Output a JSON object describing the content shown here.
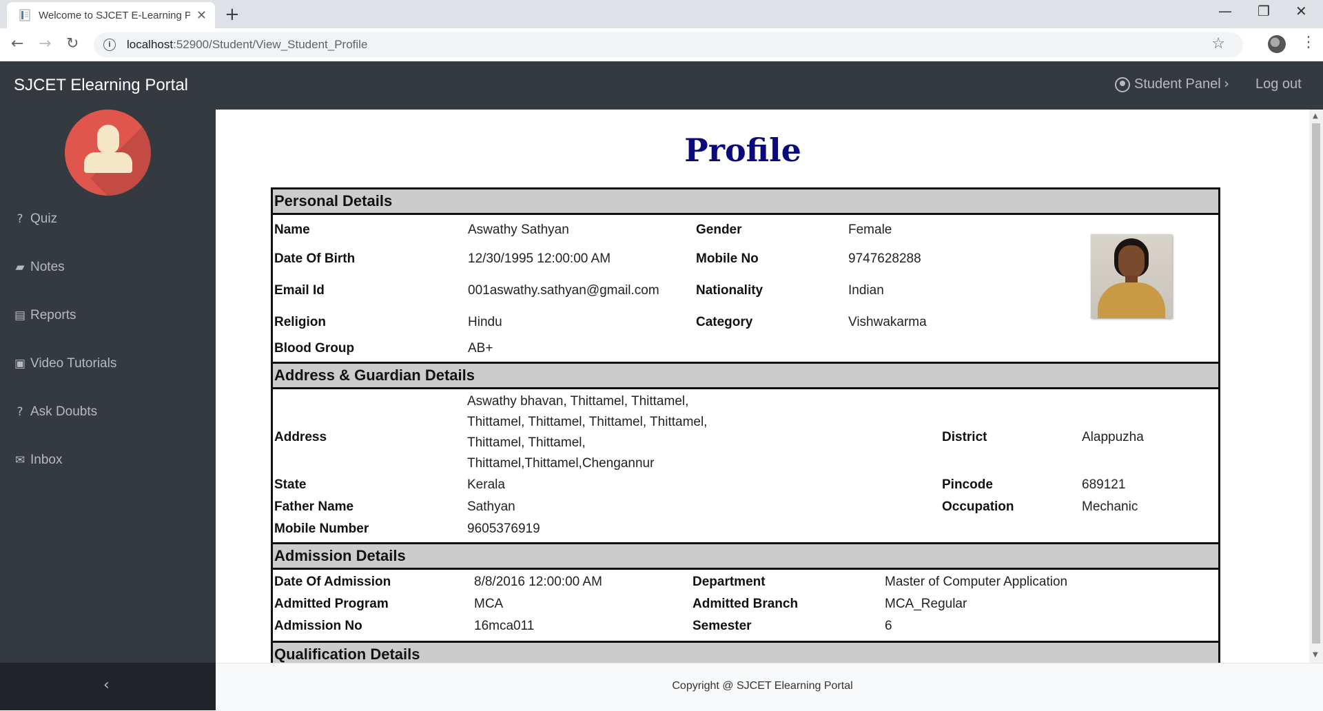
{
  "browser": {
    "tab_title": "Welcome to SJCET E-Learning Po",
    "url_host": "localhost",
    "url_path": ":52900/Student/View_Student_Profile",
    "new_tab_glyph": "+",
    "close_glyph": "✕",
    "minimize_glyph": "—",
    "restore_glyph": "❐",
    "window_close_glyph": "✕"
  },
  "header": {
    "brand": "SJCET Elearning Portal",
    "panel_label": "Student Panel",
    "logout_label": "Log out"
  },
  "sidebar": {
    "items": [
      {
        "label": "Quiz",
        "icon": "question-circle-icon",
        "glyph": "?"
      },
      {
        "label": "Notes",
        "icon": "book-icon",
        "glyph": "▰"
      },
      {
        "label": "Reports",
        "icon": "file-icon",
        "glyph": "▤"
      },
      {
        "label": "Video Tutorials",
        "icon": "video-file-icon",
        "glyph": "▣"
      },
      {
        "label": "Ask Doubts",
        "icon": "question-circle-icon",
        "glyph": "?"
      },
      {
        "label": "Inbox",
        "icon": "envelope-icon",
        "glyph": "✉"
      }
    ],
    "collapse_glyph": "‹"
  },
  "profile": {
    "title": "Profile",
    "personal": {
      "heading": "Personal Details",
      "name_label": "Name",
      "name": "Aswathy Sathyan",
      "gender_label": "Gender",
      "gender": "Female",
      "dob_label": "Date Of Birth",
      "dob": "12/30/1995 12:00:00 AM",
      "mobile_label": "Mobile No",
      "mobile": "9747628288",
      "email_label": "Email Id",
      "email": "001aswathy.sathyan@gmail.com",
      "nationality_label": "Nationality",
      "nationality": "Indian",
      "religion_label": "Religion",
      "religion": "Hindu",
      "category_label": "Category",
      "category": "Vishwakarma",
      "blood_label": "Blood Group",
      "blood": "AB+"
    },
    "address": {
      "heading": "Address & Guardian Details",
      "address_label": "Address",
      "address_lines": [
        "Aswathy bhavan, Thittamel, Thittamel,",
        "Thittamel, Thittamel, Thittamel, Thittamel,",
        "Thittamel, Thittamel,",
        "Thittamel,Thittamel,Chengannur"
      ],
      "district_label": "District",
      "district": "Alappuzha",
      "state_label": "State",
      "state": "Kerala",
      "pincode_label": "Pincode",
      "pincode": "689121",
      "father_label": "Father Name",
      "father": "Sathyan",
      "occupation_label": "Occupation",
      "occupation": "Mechanic",
      "guardian_mobile_label": "Mobile Number",
      "guardian_mobile": "9605376919"
    },
    "admission": {
      "heading": "Admission Details",
      "doa_label": "Date Of Admission",
      "doa": "8/8/2016 12:00:00 AM",
      "department_label": "Department",
      "department": "Master of Computer Application",
      "program_label": "Admitted Program",
      "program": "MCA",
      "branch_label": "Admitted Branch",
      "branch": "MCA_Regular",
      "admission_no_label": "Admission No",
      "admission_no": "16mca011",
      "semester_label": "Semester",
      "semester": "6"
    },
    "qualification": {
      "heading": "Qualification Details"
    }
  },
  "footer": {
    "copyright": "Copyright @ SJCET Elearning Portal"
  }
}
